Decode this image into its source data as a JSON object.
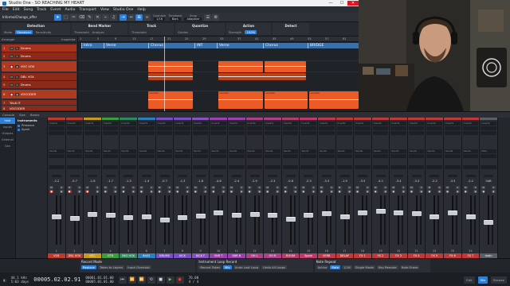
{
  "titlebar": {
    "title": "Studio One - SO REACHING MY HEART",
    "min": "—",
    "max": "☐",
    "close": "✕"
  },
  "menu": [
    "File",
    "Edit",
    "Song",
    "Track",
    "Event",
    "Audio",
    "Transport",
    "View",
    "Studio One",
    "Help"
  ],
  "toolbar": {
    "song_name": "InformalChange_offer",
    "quantize_label": "Quantize",
    "quantize_value": "1/16",
    "timebase_label": "Timebase",
    "timebase_value": "Bars",
    "snap_label": "Snap",
    "snap_value": "Adaptive"
  },
  "infobar": {
    "detection": {
      "title": "Detection",
      "mode_label": "Mode",
      "mode_value": "Standard",
      "sensitivity_label": "Sensitivity"
    },
    "bend_marker": {
      "title": "Bend Marker",
      "threshold_label": "Threshold",
      "analyze_label": "Analyze"
    },
    "track": {
      "title": "Track",
      "thresholds": "Threshold"
    },
    "quantize": {
      "title": "Quantize",
      "groups_label": "Guides"
    },
    "action": {
      "title": "Action",
      "strength_label": "Strength",
      "value": "100%"
    },
    "detect": {
      "title": "Detect"
    }
  },
  "track_panel": {
    "title": "Arranger",
    "cols": "Inspector"
  },
  "tracks": [
    {
      "num": "1",
      "name": "Drums",
      "color": "#a8321e"
    },
    {
      "num": "2",
      "name": "Drums",
      "color": "#8c2a1a"
    },
    {
      "num": "3",
      "name": "VOC VOX",
      "color": "#b03a1f"
    },
    {
      "num": "4",
      "name": "DBL VOX",
      "color": "#8c2a1a"
    },
    {
      "num": "5",
      "name": "Drums",
      "color": "#8c2a1a"
    },
    {
      "num": "6",
      "name": "VOCODER",
      "color": "#b03a1f"
    },
    {
      "num": "7",
      "name": "TALK IT",
      "color": "#8c2a1a"
    },
    {
      "num": "8",
      "name": "VOCODER",
      "color": "#8c2a1a"
    }
  ],
  "ruler": [
    "1",
    "5",
    "9",
    "13",
    "17",
    "21",
    "25",
    "29",
    "33",
    "37",
    "41",
    "45",
    "49",
    "53",
    "57",
    "61"
  ],
  "markers": [
    "Intro",
    "Verse",
    "Chorus",
    "INT",
    "Verse",
    "Chorus",
    "BRIDGE"
  ],
  "clips": [
    {
      "lane": 0,
      "label": ""
    },
    {
      "lane": 0,
      "label": ""
    },
    {
      "lane": 0,
      "label": ""
    },
    {
      "lane": 2,
      "label": "vocoder"
    },
    {
      "lane": 2,
      "label": "vocoder"
    },
    {
      "lane": 2,
      "label": "vocoder"
    },
    {
      "lane": 2,
      "label": "vocoder"
    }
  ],
  "console": {
    "head_items": [
      "Console",
      "Size",
      "Banks",
      "Inputs",
      "Outputs",
      "External"
    ],
    "nav": [
      "Instr",
      "Inputs",
      "Outputs",
      "External",
      "Gen"
    ],
    "instruments_title": "Instruments",
    "instruments": [
      "Presence",
      "Spark"
    ]
  },
  "channels": [
    {
      "name": "VOX",
      "num": "1",
      "val": "-2.2",
      "color": "#c0392b",
      "sends": "Sends"
    },
    {
      "name": "DBL VOX",
      "num": "2",
      "val": "-0.7",
      "color": "#c0392b",
      "sends": "Sends"
    },
    {
      "name": "VOC",
      "num": "3",
      "val": "-1.8",
      "color": "#c79a1b",
      "sends": "Sends"
    },
    {
      "name": "GTR",
      "num": "4",
      "val": "-1.7",
      "color": "#3e9b3e",
      "sends": "Sends"
    },
    {
      "name": "BKG VOX",
      "num": "5",
      "val": "-1.3",
      "color": "#2f8a5f",
      "sends": "Sends"
    },
    {
      "name": "BASS",
      "num": "6",
      "val": "-1.4",
      "color": "#2c7fb8",
      "sends": "Sends"
    },
    {
      "name": "DRUMS",
      "num": "7",
      "val": "-0.7",
      "color": "#7a4fc2",
      "sends": "Sends"
    },
    {
      "name": "KICK",
      "num": "8",
      "val": "-1.3",
      "color": "#7a4fc2",
      "sends": "Sends"
    },
    {
      "name": "KICK F",
      "num": "9",
      "val": "-1.8",
      "color": "#8a4fc2",
      "sends": "Sends"
    },
    {
      "name": "SNR T",
      "num": "10",
      "val": "-4.6",
      "color": "#9c3fb0",
      "sends": "Sends"
    },
    {
      "name": "SNR B",
      "num": "11",
      "val": "-2.4",
      "color": "#9c3fb0",
      "sends": "Sends"
    },
    {
      "name": "OH L",
      "num": "12",
      "val": "-2.9",
      "color": "#b03f8a",
      "sends": "Sends"
    },
    {
      "name": "OH R",
      "num": "13",
      "val": "-2.3",
      "color": "#b03f8a",
      "sends": "Sends"
    },
    {
      "name": "ROOM",
      "num": "14",
      "val": "-0.6",
      "color": "#b03f6a",
      "sends": "Sends"
    },
    {
      "name": "Spark",
      "num": "15",
      "val": "-2.3",
      "color": "#c0396a",
      "sends": "Sends"
    },
    {
      "name": "VERB",
      "num": "16",
      "val": "-3.3",
      "color": "#c0394a",
      "sends": "Sends"
    },
    {
      "name": "DELAY",
      "num": "17",
      "val": "-1.9",
      "color": "#c03939",
      "sends": "Sends"
    },
    {
      "name": "FX 1",
      "num": "18",
      "val": "-3.5",
      "color": "#c03939",
      "sends": "Sends"
    },
    {
      "name": "FX 2",
      "num": "19",
      "val": "-4.1",
      "color": "#c03939",
      "sends": "Sends"
    },
    {
      "name": "FX 3",
      "num": "20",
      "val": "-3.4",
      "color": "#c03939",
      "sends": "Sends"
    },
    {
      "name": "FX 4",
      "num": "21",
      "val": "-3.3",
      "color": "#c03939",
      "sends": "Sends"
    },
    {
      "name": "FX 5",
      "num": "22",
      "val": "-2.2",
      "color": "#c03939",
      "sends": "Sends"
    },
    {
      "name": "FX 6",
      "num": "23",
      "val": "-3.5",
      "color": "#c03939",
      "sends": "Sends"
    },
    {
      "name": "FX 7",
      "num": "24",
      "val": "-2.2",
      "color": "#c03939",
      "sends": "Sends"
    },
    {
      "name": "main",
      "num": "",
      "val": "0dB",
      "color": "#5a5f66",
      "sends": "Main"
    }
  ],
  "transport": {
    "record_mode": {
      "title": "Record Mode",
      "opts": [
        "Replace",
        "Takes to Layers",
        "Input Overdub"
      ]
    },
    "loop_record": {
      "title": "Instrument Loop Record",
      "opts": [
        "Record Takes",
        "Mix",
        "Undo Last Loop",
        "Undo All Loops"
      ]
    },
    "note_repeat": {
      "title": "Note Repeat",
      "opts": [
        "Active",
        "Rate",
        "1/16",
        "Single Mode",
        "Key Remote",
        "Note Erase"
      ]
    },
    "sample_rate": "44.1 kHz",
    "record_max": "5:03 days",
    "position_label": "00005.02.02.91",
    "position_sec": "00001.01.01.00",
    "position_sec2": "00005.01.01.00",
    "tempo": "76.00",
    "signature": "4 / 4",
    "tabs": [
      "Edit",
      "Mix",
      "Browse"
    ],
    "active_tab": "Mix"
  }
}
